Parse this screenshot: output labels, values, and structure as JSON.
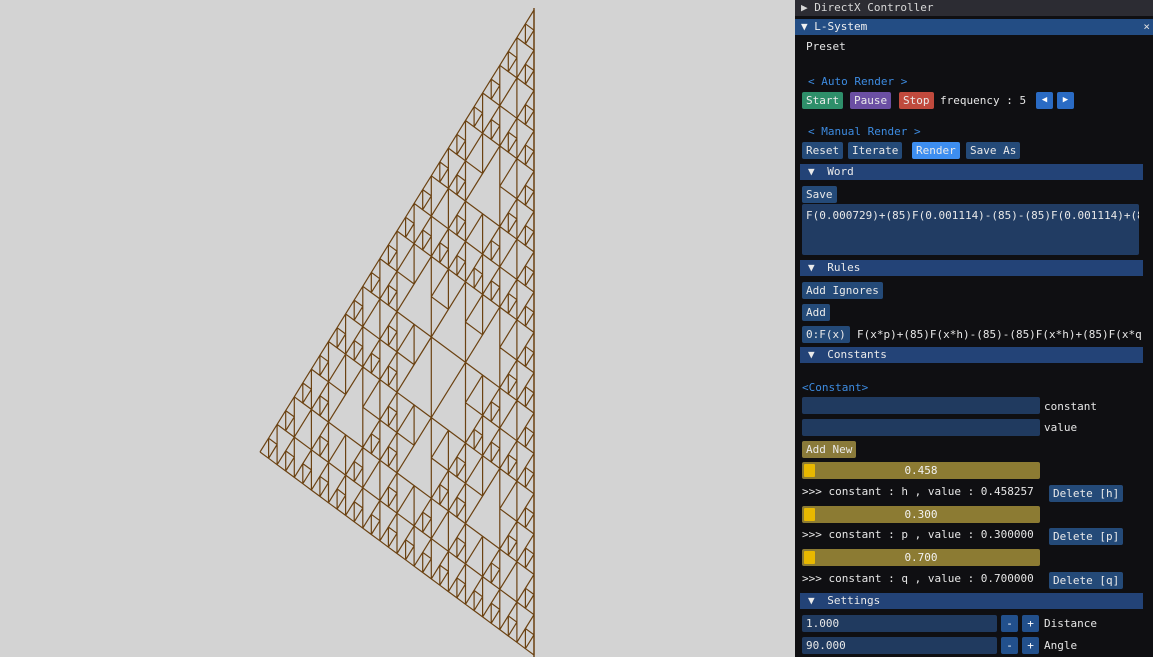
{
  "windows": {
    "directx_title": "DirectX Controller",
    "lsystem_title": "L-System",
    "close_symbol": "×"
  },
  "preset_label": "Preset",
  "auto_render": {
    "header": "< Auto Render >",
    "start": "Start",
    "pause": "Pause",
    "stop": "Stop",
    "frequency_label": "frequency : 5"
  },
  "manual_render": {
    "header": "< Manual Render >",
    "reset": "Reset",
    "iterate": "Iterate",
    "render": "Render",
    "save_as": "Save As"
  },
  "word": {
    "header": "Word",
    "save": "Save",
    "text": "F(0.000729)+(85)F(0.001114)-(85)-(85)F(0.001114)+(8"
  },
  "rules": {
    "header": "Rules",
    "add_ignores": "Add Ignores",
    "add": "Add",
    "rule_name": "0:F(x)",
    "rule_text": "F(x*p)+(85)F(x*h)-(85)-(85)F(x*h)+(85)F(x*q"
  },
  "constants": {
    "header": "Constants",
    "section_label": "<Constant>",
    "constant_field_label": "constant",
    "value_field_label": "value",
    "add_new": "Add New",
    "items": [
      {
        "slider_text": "0.458",
        "slider_value": 0.458,
        "info": ">>> constant : h  , value : 0.458257",
        "delete": "Delete [h]"
      },
      {
        "slider_text": "0.300",
        "slider_value": 0.3,
        "info": ">>> constant : p  , value : 0.300000",
        "delete": "Delete [p]"
      },
      {
        "slider_text": "0.700",
        "slider_value": 0.7,
        "info": ">>> constant : q  , value : 0.700000",
        "delete": "Delete [q]"
      }
    ]
  },
  "settings": {
    "header": "Settings",
    "distance_value": "1.000",
    "distance_label": "Distance",
    "angle_value": "90.000",
    "angle_label": "Angle"
  },
  "icons": {
    "collapse": "▼",
    "expand": "▶",
    "left_arrow": "◀",
    "right_arrow": "▶",
    "minus": "-",
    "plus": "+"
  },
  "colors": {
    "fractal": "#6b4212",
    "accent": "#3d8ef0",
    "slider_grab": "#e8b800"
  }
}
